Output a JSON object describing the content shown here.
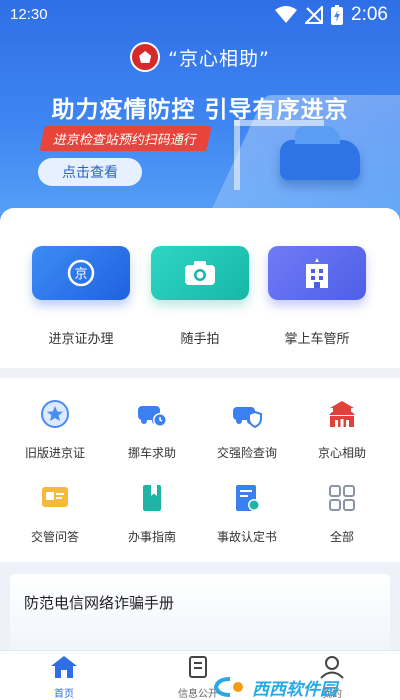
{
  "status_bar": {
    "time_left": "12:30",
    "time_right": "2:06"
  },
  "banner": {
    "brand": "“京心相助”",
    "headline": "助力疫情防控 引导有序进京",
    "subline": "进京检查站预约扫码通行",
    "button": "点击查看"
  },
  "main_tiles": [
    {
      "label": "进京证办理",
      "icon": "jing-badge-icon"
    },
    {
      "label": "随手拍",
      "icon": "camera-icon"
    },
    {
      "label": "掌上车管所",
      "icon": "building-icon"
    }
  ],
  "services": [
    {
      "label": "旧版进京证",
      "icon": "star-badge-icon"
    },
    {
      "label": "挪车求助",
      "icon": "car-clock-icon"
    },
    {
      "label": "交强险查询",
      "icon": "car-shield-icon"
    },
    {
      "label": "京心相助",
      "icon": "tiananmen-icon"
    },
    {
      "label": "交管问答",
      "icon": "chat-icon"
    },
    {
      "label": "办事指南",
      "icon": "book-icon"
    },
    {
      "label": "事故认定书",
      "icon": "document-icon"
    },
    {
      "label": "全部",
      "icon": "grid-icon"
    }
  ],
  "notice": {
    "title": "防范电信网络诈骗手册"
  },
  "nav": [
    {
      "label": "首页"
    },
    {
      "label": "信息公开"
    },
    {
      "label": "我的"
    }
  ],
  "watermark": "西西软件园",
  "colors": {
    "primary": "#2f6fe6",
    "accent_red": "#e8443a",
    "teal": "#18b7a8",
    "indigo": "#4f5ee6"
  }
}
